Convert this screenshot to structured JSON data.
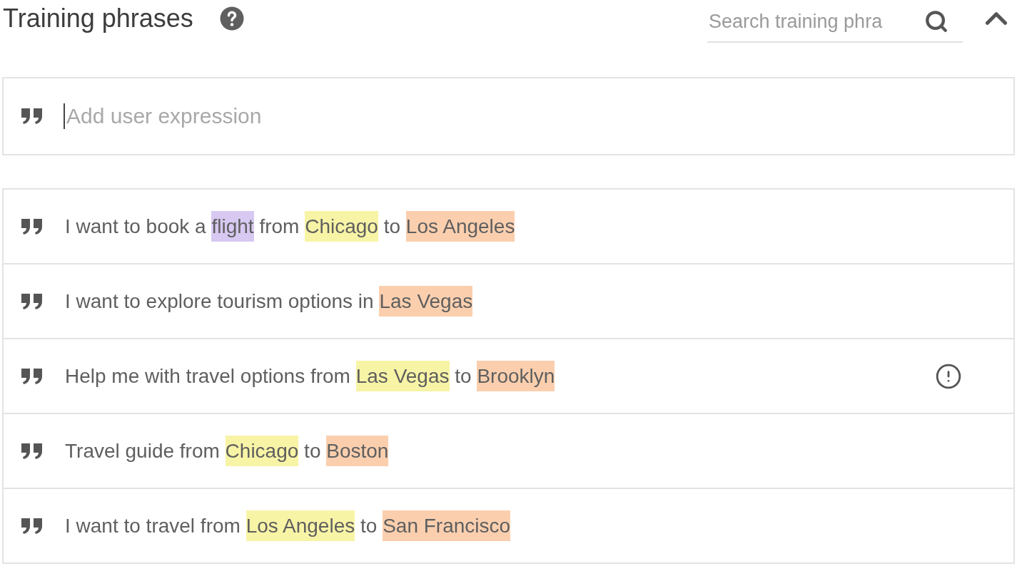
{
  "header": {
    "title": "Training phrases",
    "search": {
      "placeholder": "Search training phra"
    }
  },
  "new_phrase": {
    "placeholder": "Add user expression"
  },
  "phrases": [
    {
      "warning": false,
      "segments": [
        {
          "text": "I want to book a "
        },
        {
          "text": "flight",
          "color": "#d7c9f1"
        },
        {
          "text": " from "
        },
        {
          "text": "Chicago",
          "color": "#f8f4a6"
        },
        {
          "text": " to "
        },
        {
          "text": "Los Angeles",
          "color": "#fbcfae"
        }
      ]
    },
    {
      "warning": false,
      "segments": [
        {
          "text": "I want to explore tourism options in "
        },
        {
          "text": "Las Vegas",
          "color": "#fbcfae"
        }
      ]
    },
    {
      "warning": true,
      "segments": [
        {
          "text": "Help me with travel options from "
        },
        {
          "text": "Las Vegas",
          "color": "#f8f4a6"
        },
        {
          "text": " to "
        },
        {
          "text": "Brooklyn",
          "color": "#fbcfae"
        }
      ]
    },
    {
      "warning": false,
      "segments": [
        {
          "text": "Travel guide from "
        },
        {
          "text": "Chicago",
          "color": "#f8f4a6"
        },
        {
          "text": " to "
        },
        {
          "text": "Boston",
          "color": "#fbcfae"
        }
      ]
    },
    {
      "warning": false,
      "segments": [
        {
          "text": "I want to travel from "
        },
        {
          "text": "Los Angeles",
          "color": "#f8f4a6"
        },
        {
          "text": " to "
        },
        {
          "text": "San Francisco",
          "color": "#fbcfae"
        }
      ]
    }
  ]
}
